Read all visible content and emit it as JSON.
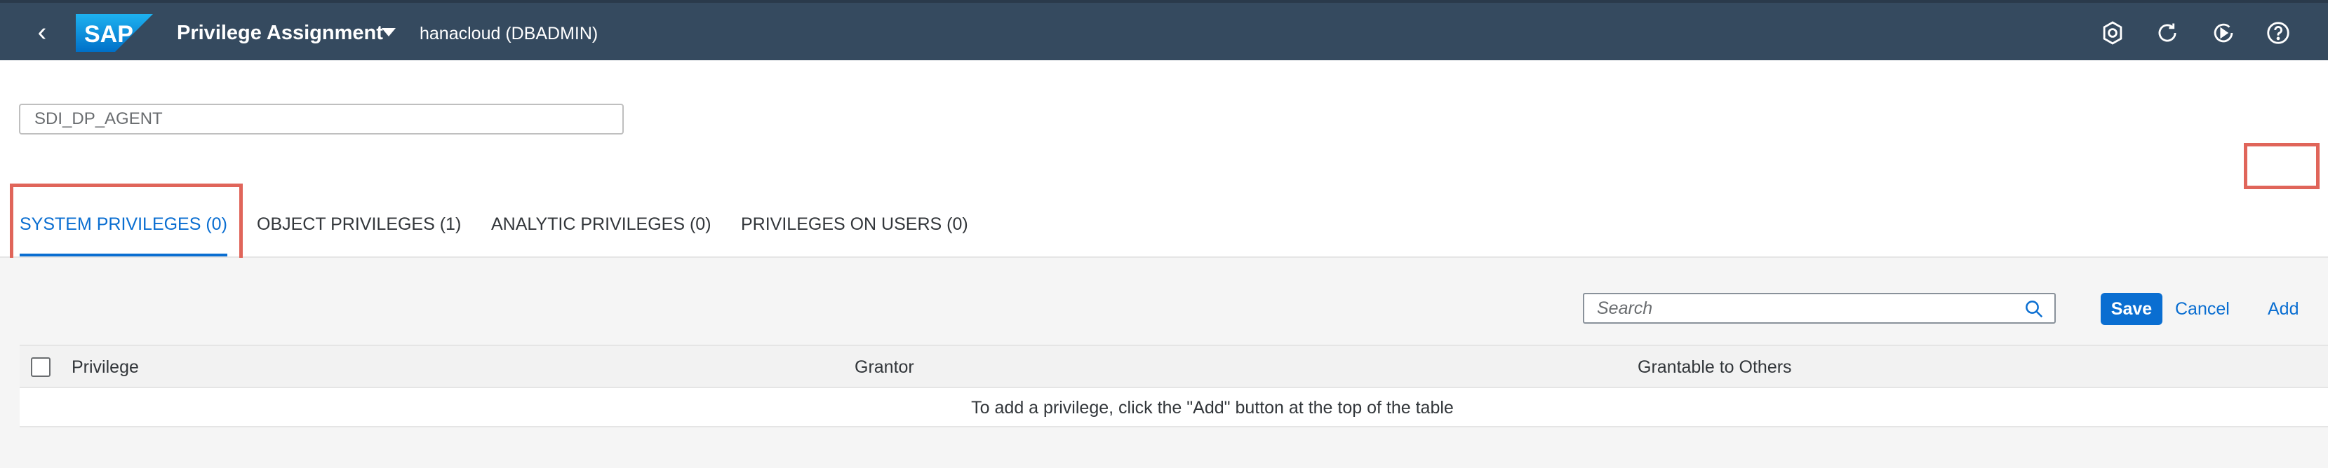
{
  "shell": {
    "title": "Privilege Assignment",
    "connection": "hanacloud (DBADMIN)",
    "logo_text": "SAP",
    "icons": [
      "back-icon",
      "settings-icon",
      "refresh-icon",
      "run-icon",
      "help-icon"
    ],
    "colors": {
      "bar": "#354a5f",
      "text": "#ffffff"
    }
  },
  "object_name": {
    "value": "SDI_DP_AGENT"
  },
  "tabs": [
    {
      "label": "SYSTEM PRIVILEGES (0)",
      "active": true
    },
    {
      "label": "OBJECT PRIVILEGES (1)",
      "active": false
    },
    {
      "label": "ANALYTIC PRIVILEGES (0)",
      "active": false
    },
    {
      "label": "PRIVILEGES ON USERS (0)",
      "active": false
    }
  ],
  "toolbar": {
    "search_placeholder": "Search",
    "save_label": "Save",
    "cancel_label": "Cancel",
    "add_label": "Add"
  },
  "table": {
    "columns": [
      "Privilege",
      "Grantor",
      "Grantable to Others"
    ],
    "empty_text": "To add a privilege, click the \"Add\" button at the top of the table"
  },
  "colors": {
    "accent": "#0a6ed1",
    "highlight": "#e0655a"
  }
}
